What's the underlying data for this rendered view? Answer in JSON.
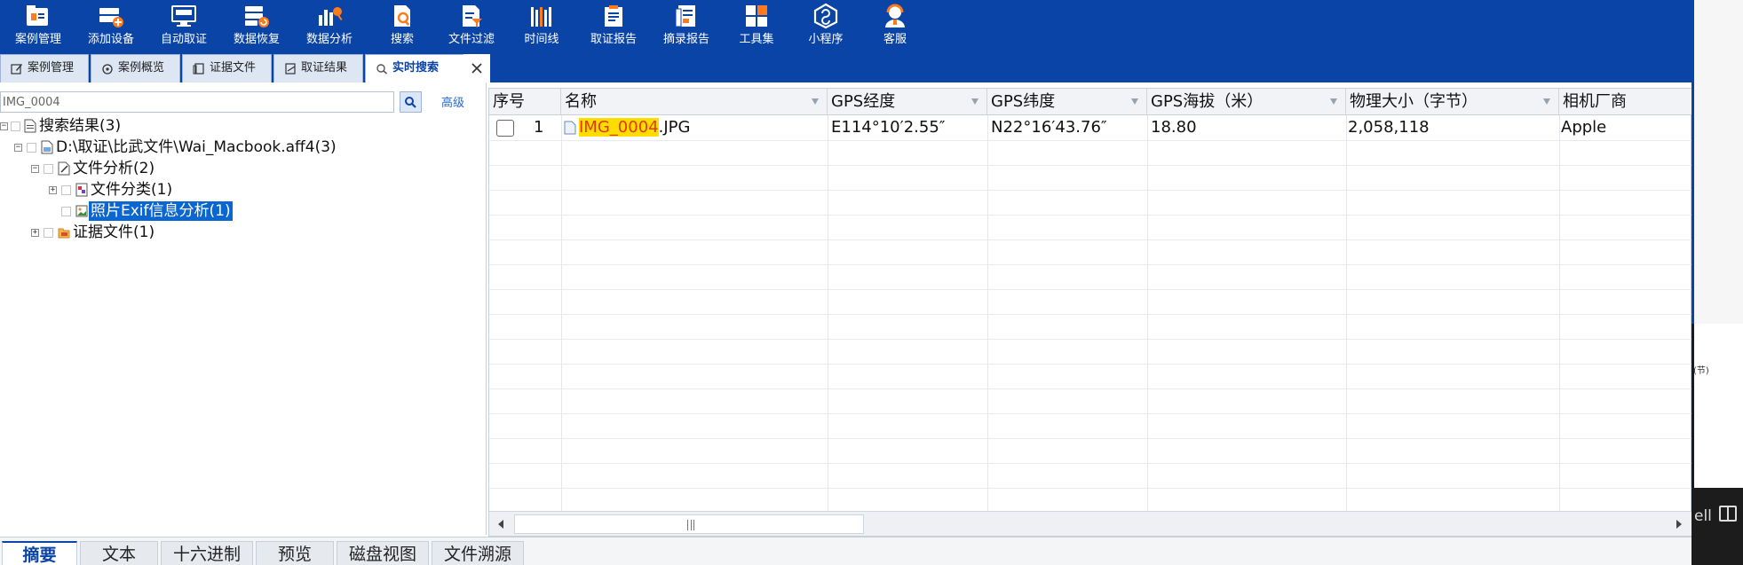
{
  "toolbar": {
    "items": [
      {
        "label": "案例管理",
        "icon": "case-management-icon"
      },
      {
        "label": "添加设备",
        "icon": "add-device-icon"
      },
      {
        "label": "自动取证",
        "icon": "auto-forensics-icon"
      },
      {
        "label": "数据恢复",
        "icon": "data-recovery-icon"
      },
      {
        "label": "数据分析",
        "icon": "data-analysis-icon"
      },
      {
        "label": "搜索",
        "icon": "search-icon"
      },
      {
        "label": "文件过滤",
        "icon": "file-filter-icon"
      },
      {
        "label": "时间线",
        "icon": "timeline-icon"
      },
      {
        "label": "取证报告",
        "icon": "forensics-report-icon"
      },
      {
        "label": "摘录报告",
        "icon": "excerpt-report-icon"
      },
      {
        "label": "工具集",
        "icon": "toolset-icon"
      },
      {
        "label": "小程序",
        "icon": "mini-program-icon"
      },
      {
        "label": "客服",
        "icon": "customer-service-icon"
      }
    ],
    "icon_accent": "#ff7a1a",
    "background": "#0a44a6"
  },
  "tabs": [
    {
      "label": "案例管理",
      "icon": "edit-icon"
    },
    {
      "label": "案例概览",
      "icon": "overview-icon"
    },
    {
      "label": "证据文件",
      "icon": "file-icon"
    },
    {
      "label": "取证结果",
      "icon": "result-icon"
    },
    {
      "label": "实时搜索",
      "icon": "search-icon",
      "active": true
    }
  ],
  "close_icon": "close-icon",
  "search": {
    "value": "IMG_0004",
    "advanced_label": "高级"
  },
  "tree": {
    "nodes": [
      {
        "label": "搜索结果(3)",
        "icon": "document-icon"
      },
      {
        "label": "D:\\取证\\比武文件\\Wai_Macbook.aff4(3)",
        "icon": "evidence-file-icon"
      },
      {
        "label": "文件分析(2)",
        "icon": "file-analysis-icon"
      },
      {
        "label": "文件分类(1)",
        "icon": "file-category-icon"
      },
      {
        "label": "照片Exif信息分析(1)",
        "icon": "photo-exif-icon",
        "selected": true
      },
      {
        "label": "证据文件(1)",
        "icon": "folder-icon"
      }
    ]
  },
  "grid": {
    "columns": [
      "序号",
      "名称",
      "GPS经度",
      "GPS纬度",
      "GPS海拔（米）",
      "物理大小（字节）",
      "相机厂商"
    ],
    "rows": [
      {
        "index": "1",
        "name_highlight": "IMG_0004",
        "name_rest": ".JPG",
        "gps_longitude": "E114°10′2.55″",
        "gps_latitude": "N22°16′43.76″",
        "gps_altitude": "18.80",
        "physical_size": "2,058,118",
        "camera_maker": "Apple"
      }
    ],
    "highlight_color": "#ffdd00"
  },
  "bottom_tabs": [
    {
      "label": "摘要",
      "active": true
    },
    {
      "label": "文本"
    },
    {
      "label": "十六进制"
    },
    {
      "label": "预览"
    },
    {
      "label": "磁盘视图"
    },
    {
      "label": "文件溯源"
    }
  ],
  "background_window": {
    "fragment_text": "(节)",
    "terminal_fragment": "ell"
  }
}
